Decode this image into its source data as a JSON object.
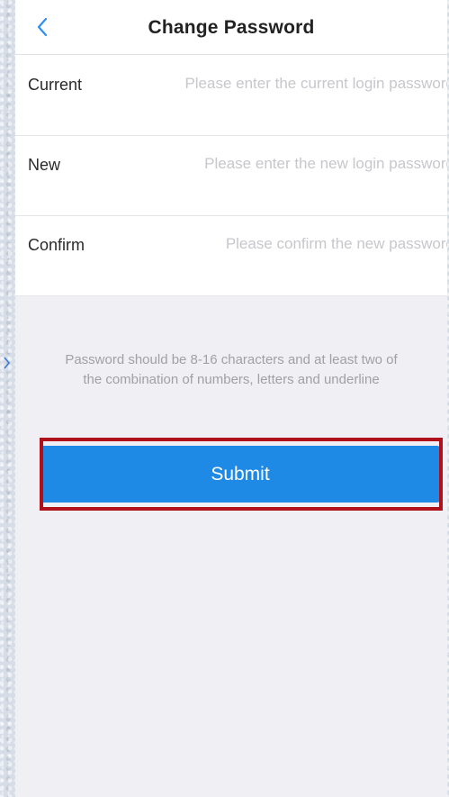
{
  "header": {
    "title": "Change Password",
    "back_icon": "chevron-left-icon"
  },
  "form": {
    "rows": [
      {
        "label": "Current",
        "placeholder": "Please enter the current login password",
        "value": ""
      },
      {
        "label": "New",
        "placeholder": "Please enter the new login password",
        "value": ""
      },
      {
        "label": "Confirm",
        "placeholder": "Please confirm the new password",
        "value": ""
      }
    ]
  },
  "hint": {
    "line1": "Password should be 8-16 characters and at least two of",
    "line2": "the combination of numbers, letters and underline"
  },
  "submit": {
    "label": "Submit"
  },
  "colors": {
    "accent": "#1f8ae6",
    "highlight": "#b0101a",
    "background": "#efeff4"
  }
}
